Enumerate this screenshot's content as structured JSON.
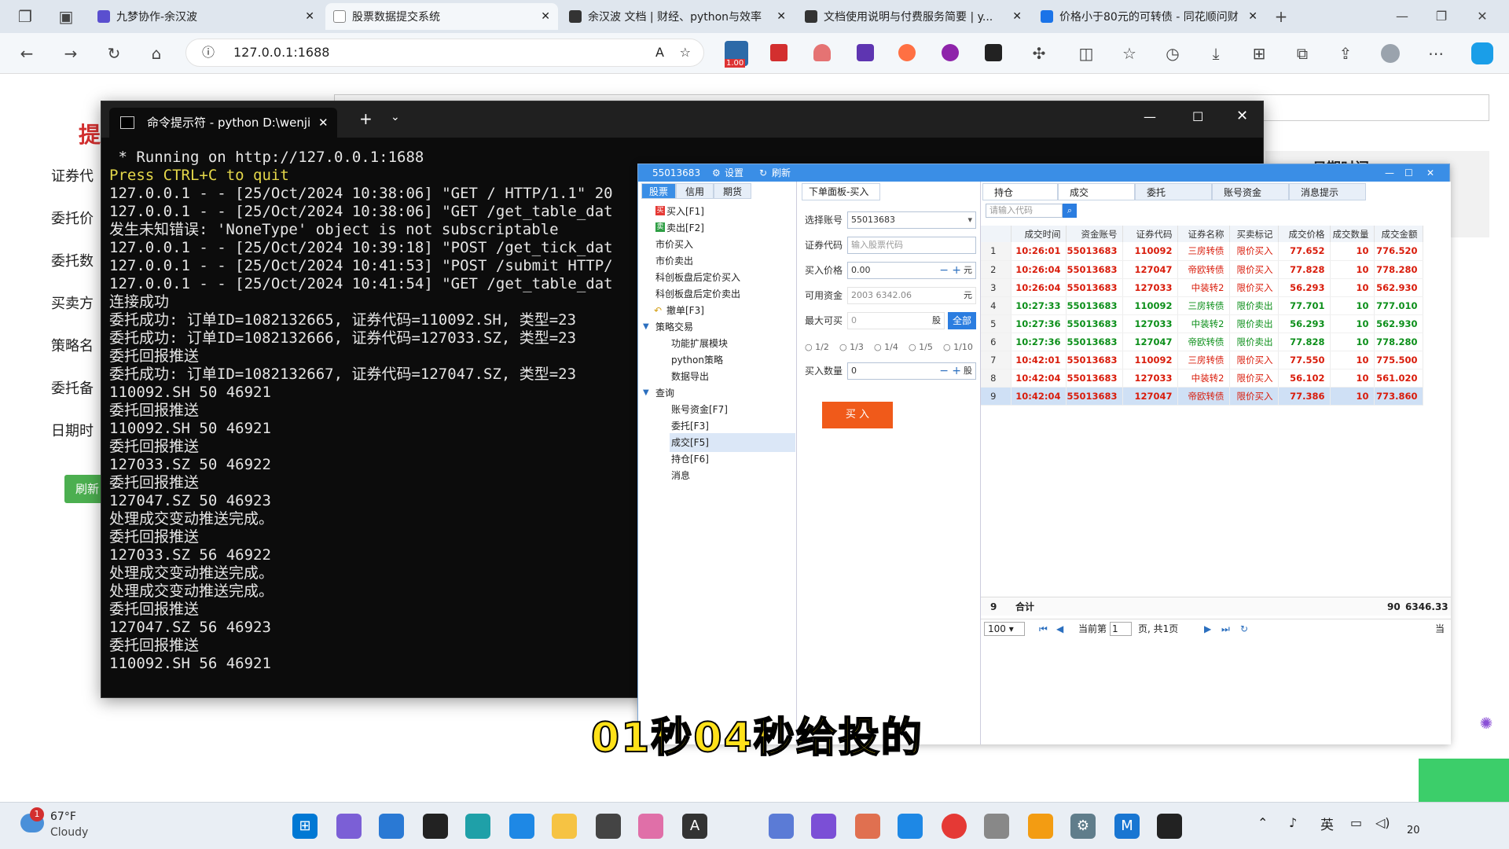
{
  "browser": {
    "tabs": [
      {
        "title": "九梦协作-余汉波",
        "color": "#5a4fcf"
      },
      {
        "title": "股票数据提交系统",
        "color": "#888888"
      },
      {
        "title": "余汉波 文档 | 财经、python与效率",
        "color": "#333333"
      },
      {
        "title": "文档使用说明与付费服务简要 | y...",
        "color": "#333333"
      },
      {
        "title": "价格小于80元的可转债 - 同花顺问财",
        "color": "#1a73e8"
      }
    ],
    "address": "127.0.0.1:1688",
    "badge": "1.00"
  },
  "page": {
    "heading": "提",
    "labels": [
      "证券代",
      "委托价",
      "委托数",
      "买卖方",
      "策略名",
      "委托备",
      "日期时"
    ],
    "refresh_label": "刷新",
    "right_header": "日期时间"
  },
  "terminal": {
    "tab_title": "命令提示符 - python  D:\\wenji",
    "lines": [
      " * Running on http://127.0.0.1:1688",
      "Press CTRL+C to quit",
      "127.0.0.1 - - [25/Oct/2024 10:38:06] \"GET / HTTP/1.1\" 20",
      "127.0.0.1 - - [25/Oct/2024 10:38:06] \"GET /get_table_dat",
      "发生未知错误: 'NoneType' object is not subscriptable",
      "127.0.0.1 - - [25/Oct/2024 10:39:18] \"POST /get_tick_dat",
      "127.0.0.1 - - [25/Oct/2024 10:41:53] \"POST /submit HTTP/",
      "127.0.0.1 - - [25/Oct/2024 10:41:54] \"GET /get_table_dat",
      "连接成功",
      "委托成功: 订单ID=1082132665, 证券代码=110092.SH, 类型=23",
      "委托成功: 订单ID=1082132666, 证券代码=127033.SZ, 类型=23",
      "委托回报推送",
      "委托成功: 订单ID=1082132667, 证券代码=127047.SZ, 类型=23",
      "110092.SH 50 46921",
      "委托回报推送",
      "110092.SH 50 46921",
      "委托回报推送",
      "127033.SZ 50 46922",
      "委托回报推送",
      "127047.SZ 50 46923",
      "处理成交变动推送完成。",
      "委托回报推送",
      "127033.SZ 56 46922",
      "处理成交变动推送完成。",
      "处理成交变动推送完成。",
      "委托回报推送",
      "127047.SZ 56 46923",
      "委托回报推送",
      "110092.SH 56 46921"
    ]
  },
  "trade": {
    "account_title": "55013683",
    "settings": "设置",
    "refresh": "刷新",
    "nav_tabs": [
      "股票",
      "信用",
      "期货"
    ],
    "nav_items": [
      "买入[F1]",
      "卖出[F2]",
      "市价买入",
      "市价卖出",
      "科创板盘后定价买入",
      "科创板盘后定价卖出",
      "撤单[F3]",
      "策略交易",
      "功能扩展模块",
      "python策略",
      "数据导出",
      "查询",
      "账号资金[F7]",
      "委托[F3]",
      "成交[F5]",
      "持仓[F6]",
      "消息"
    ],
    "form": {
      "panel_title": "下单面板-买入",
      "account_label": "选择账号",
      "account_value": "55013683",
      "code_label": "证券代码",
      "code_placeholder": "输入股票代码",
      "price_label": "买入价格",
      "price_value": "0.00",
      "price_unit": "元",
      "fund_label": "可用资金",
      "fund_value": "2003 6342.06",
      "fund_unit": "元",
      "max_label": "最大可买",
      "max_value": "0",
      "max_unit": "股",
      "all_btn": "全部",
      "ratios": [
        "1/2",
        "1/3",
        "1/4",
        "1/5",
        "1/10"
      ],
      "qty_label": "买入数量",
      "qty_value": "0",
      "qty_unit": "股",
      "buy_btn": "买 入"
    },
    "grid_tabs": [
      "持仓",
      "成交",
      "委托",
      "账号资金",
      "消息提示"
    ],
    "search_placeholder": "请输入代码",
    "columns": [
      "成交时间",
      "资金账号",
      "证券代码",
      "证券名称",
      "买卖标记",
      "成交价格",
      "成交数量",
      "成交金额"
    ],
    "rows": [
      [
        "10:26:01",
        "55013683",
        "110092",
        "三房转债",
        "限价买入",
        "77.652",
        "10",
        "776.520"
      ],
      [
        "10:26:04",
        "55013683",
        "127047",
        "帝欧转债",
        "限价买入",
        "77.828",
        "10",
        "778.280"
      ],
      [
        "10:26:04",
        "55013683",
        "127033",
        "中装转2",
        "限价买入",
        "56.293",
        "10",
        "562.930"
      ],
      [
        "10:27:33",
        "55013683",
        "110092",
        "三房转债",
        "限价卖出",
        "77.701",
        "10",
        "777.010"
      ],
      [
        "10:27:36",
        "55013683",
        "127033",
        "中装转2",
        "限价卖出",
        "56.293",
        "10",
        "562.930"
      ],
      [
        "10:27:36",
        "55013683",
        "127047",
        "帝欧转债",
        "限价卖出",
        "77.828",
        "10",
        "778.280"
      ],
      [
        "10:42:01",
        "55013683",
        "110092",
        "三房转债",
        "限价买入",
        "77.550",
        "10",
        "775.500"
      ],
      [
        "10:42:04",
        "55013683",
        "127033",
        "中装转2",
        "限价买入",
        "56.102",
        "10",
        "561.020"
      ],
      [
        "10:42:04",
        "55013683",
        "127047",
        "帝欧转债",
        "限价买入",
        "77.386",
        "10",
        "773.860"
      ]
    ],
    "total": {
      "count": "9",
      "label": "合计",
      "qty": "90",
      "amount": "6346.33"
    },
    "pager": {
      "size": "100",
      "page_label": "当前第",
      "page": "1",
      "of": "页, 共1页",
      "right": "当"
    }
  },
  "caption": "01秒04秒给投的",
  "taskbar": {
    "temp": "67°F",
    "weather": "Cloudy",
    "notif": "1",
    "ime": "英",
    "clock": "20"
  }
}
